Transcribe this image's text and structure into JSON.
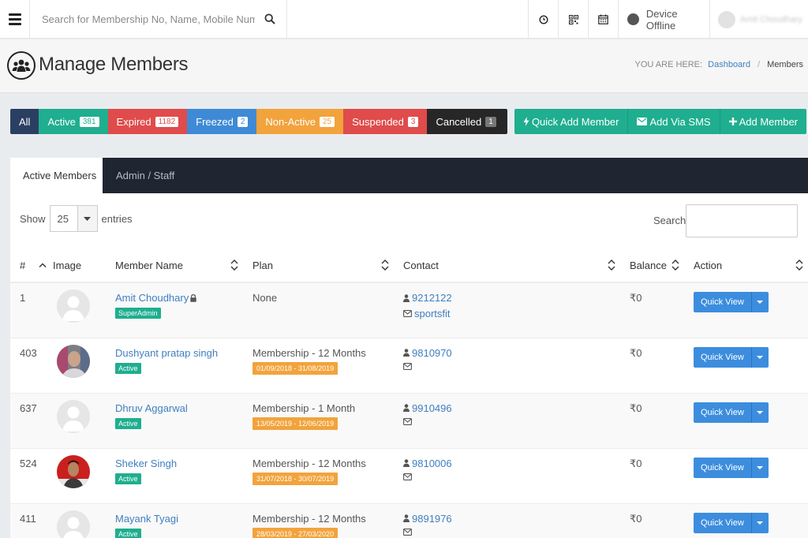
{
  "topbar": {
    "search_placeholder": "Search for Membership No, Name, Mobile Number",
    "device_status": "Device Offline",
    "user_name": "Amit Choudhary"
  },
  "header": {
    "title": "Manage Members",
    "breadcrumb_prefix": "YOU ARE HERE:",
    "breadcrumb_link": "Dashboard",
    "breadcrumb_current": "Members"
  },
  "filters": [
    {
      "label": "All",
      "count": null,
      "color": "#2b3f63"
    },
    {
      "label": "Active",
      "count": "381",
      "color": "#1fae8f"
    },
    {
      "label": "Expired",
      "count": "1182",
      "color": "#e04b4b"
    },
    {
      "label": "Freezed",
      "count": "2",
      "color": "#3f8ad6"
    },
    {
      "label": "Non-Active",
      "count": "25",
      "color": "#f2a33c"
    },
    {
      "label": "Suspended",
      "count": "3",
      "color": "#e04b4b"
    },
    {
      "label": "Cancelled",
      "count": "1",
      "color": "#272727"
    }
  ],
  "actions": {
    "quick_add": "Quick Add Member",
    "add_sms": "Add Via SMS",
    "add_member": "Add Member"
  },
  "tabs": {
    "active": "Active Members",
    "staff": "Admin / Staff"
  },
  "controls": {
    "show_label": "Show",
    "page_size": "25",
    "entries_label": "entries",
    "search_label": "Search:"
  },
  "columns": {
    "num": "#",
    "image": "Image",
    "name": "Member Name",
    "plan": "Plan",
    "contact": "Contact",
    "balance": "Balance",
    "action": "Action"
  },
  "rows": [
    {
      "id": "1",
      "name": "Amit Choudhary",
      "locked": true,
      "badge": "SuperAdmin",
      "plan": "None",
      "range": "",
      "phone": "9212122",
      "email": "sportsfit",
      "balance": "₹0",
      "action": "Quick View",
      "avatar": "placeholder"
    },
    {
      "id": "403",
      "name": "Dushyant pratap singh",
      "locked": false,
      "badge": "Active",
      "plan": "Membership - 12 Months",
      "range": "01/09/2018 - 31/08/2019",
      "phone": "9810970",
      "email": "",
      "balance": "₹0",
      "action": "Quick View",
      "avatar": "photo-1"
    },
    {
      "id": "637",
      "name": "Dhruv Aggarwal",
      "locked": false,
      "badge": "Active",
      "plan": "Membership - 1 Month",
      "range": "13/05/2019 - 12/06/2019",
      "phone": "9910496",
      "email": "",
      "balance": "₹0",
      "action": "Quick View",
      "avatar": "placeholder"
    },
    {
      "id": "524",
      "name": "Sheker Singh",
      "locked": false,
      "badge": "Active",
      "plan": "Membership - 12 Months",
      "range": "31/07/2018 - 30/07/2019",
      "phone": "9810006",
      "email": "",
      "balance": "₹0",
      "action": "Quick View",
      "avatar": "photo-2"
    },
    {
      "id": "411",
      "name": "Mayank Tyagi",
      "locked": false,
      "badge": "Active",
      "plan": "Membership - 12 Months",
      "range": "28/03/2019 - 27/03/2020",
      "phone": "9891976",
      "email": "",
      "balance": "₹0",
      "action": "Quick View",
      "avatar": "placeholder"
    }
  ]
}
